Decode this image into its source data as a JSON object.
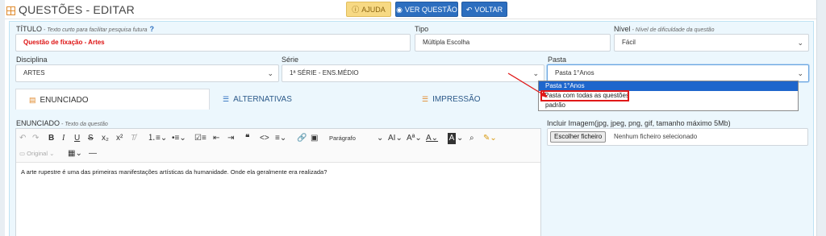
{
  "header": {
    "title": "QUESTÕES - EDITAR",
    "grid_icon": "grid-icon",
    "buttons": {
      "help": "AJUDA",
      "view": "VER QUESTÃO",
      "back": "VOLTAR"
    }
  },
  "form": {
    "titulo": {
      "label": "TÍTULO",
      "hint": "- Texto curto para facilitar pesquisa futura",
      "help_mark": "?",
      "value": "Questão de fixação - Artes"
    },
    "tipo": {
      "label": "Tipo",
      "value": "Múltipla Escolha"
    },
    "nivel": {
      "label": "Nível",
      "hint": "- Nível de dificuldade da questão",
      "value": "Fácil"
    },
    "disciplina": {
      "label": "Disciplina",
      "value": "ARTES"
    },
    "serie": {
      "label": "Série",
      "value": "1ª SÉRIE - ENS.MÉDIO"
    },
    "pasta": {
      "label": "Pasta",
      "value": "Pasta 1°Anos",
      "options": [
        "Pasta 1°Anos",
        "Pasta com todas as questões",
        "padrão"
      ]
    }
  },
  "tabs": [
    {
      "label": "ENUNCIADO",
      "active": true
    },
    {
      "label": "ALTERNATIVAS",
      "active": false
    },
    {
      "label": "IMPRESSÃO",
      "active": false
    }
  ],
  "editor": {
    "label": "ENUNCIADO",
    "hint": "- Texto da questão",
    "paragraph_select": "Parágrafo",
    "original_label": "Original",
    "content": "A arte rupestre é uma das primeiras manifestações artísticas da humanidade. Onde ela geralmente era realizada?"
  },
  "image_upload": {
    "label": "Incluir Imagem(jpg, jpeg, png, gif, tamanho máximo 5Mb)",
    "button": "Escolher ficheiro",
    "status": "Nenhum ficheiro selecionado"
  },
  "colors": {
    "accent": "#2c6ebf",
    "panel_bg": "#ecf7fd",
    "help_bg": "#f7d983",
    "highlight_red": "#e01818",
    "title_red": "#dd1111"
  }
}
